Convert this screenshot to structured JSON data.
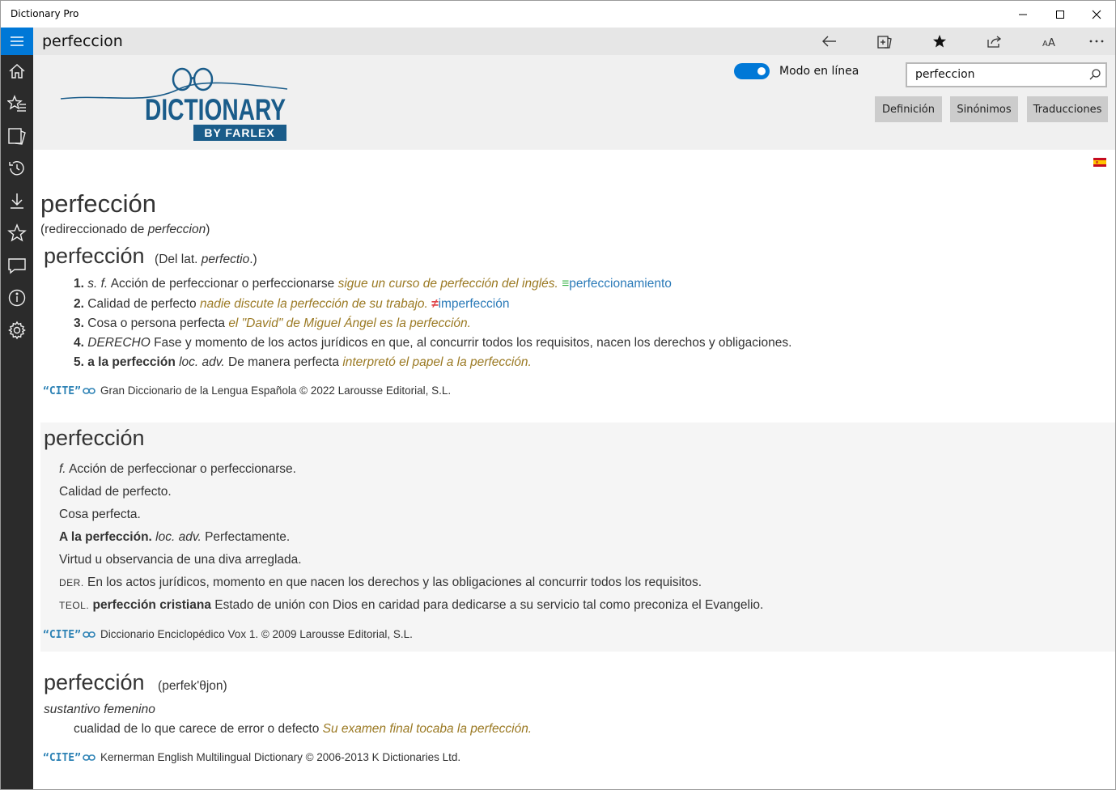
{
  "window": {
    "title": "Dictionary Pro",
    "controls": [
      "minimize",
      "maximize",
      "close"
    ]
  },
  "sidebar": {
    "items": [
      {
        "icon": "menu-icon"
      },
      {
        "icon": "home-icon"
      },
      {
        "icon": "starred-list-icon"
      },
      {
        "icon": "flashcards-icon"
      },
      {
        "icon": "history-icon"
      },
      {
        "icon": "download-icon"
      },
      {
        "icon": "star-outline-icon"
      },
      {
        "icon": "feedback-icon"
      },
      {
        "icon": "info-icon"
      },
      {
        "icon": "settings-icon"
      }
    ]
  },
  "cmdbar": {
    "query": "perfeccion",
    "icons": [
      "back-arrow-icon",
      "add-flashcard-icon",
      "favorite-star-icon",
      "share-icon",
      "font-size-icon",
      "more-icon"
    ]
  },
  "header": {
    "logo_title": "DICTIONARY",
    "logo_sub": "BY FARLEX",
    "toggle_label": "Modo en línea",
    "toggle_on": true,
    "search_value": "perfeccion",
    "tabs": [
      "Definición",
      "Sinónimos",
      "Traducciones"
    ]
  },
  "entry": {
    "headword": "perfección",
    "redirect_prefix": "(redireccionado de ",
    "redirect_word": "perfeccion",
    "redirect_suffix": ")",
    "section1": {
      "head": "perfección",
      "etym_prefix": "(Del lat. ",
      "etym_word": "perfectio",
      "etym_suffix": ".)",
      "defs": [
        {
          "n": "1.",
          "gram": "s. f.",
          "text": "Acción de perfeccionar o perfeccionarse",
          "example": "sigue un curso de perfección del inglés.",
          "rel_symbol": "≡",
          "rel": "perfeccionamiento"
        },
        {
          "n": "2.",
          "text": "Calidad de perfecto",
          "example": "nadie discute la perfección de su trabajo.",
          "rel_symbol": "≠",
          "rel": "imperfección"
        },
        {
          "n": "3.",
          "text": "Cosa o persona perfecta",
          "example": "el \"David\" de Miguel Ángel es la perfección."
        },
        {
          "n": "4.",
          "field": "DERECHO",
          "text": "Fase y momento de los actos jurídicos en que, al concurrir todos los requisitos, nacen los derechos y obligaciones."
        },
        {
          "n": "5.",
          "phrase": "a la perfección",
          "gram": "loc. adv.",
          "text": "De manera perfecta",
          "example": "interpretó el papel a la perfección."
        }
      ],
      "cite_label": "“CITE”",
      "source": "Gran Diccionario de la Lengua Española © 2022 Larousse Editorial, S.L."
    },
    "section2": {
      "head": "perfección",
      "lines": [
        {
          "gram": "f.",
          "text": "Acción de perfeccionar o perfeccionarse."
        },
        {
          "text": "Calidad de perfecto."
        },
        {
          "text": "Cosa perfecta."
        },
        {
          "phrase": "A la perfección.",
          "gram": "loc. adv.",
          "text": "Perfectamente."
        },
        {
          "text": "Virtud u observancia de una diva arreglada."
        },
        {
          "field": "DER.",
          "text": "En los actos jurídicos, momento en que nacen los derechos y las obligaciones al concurrir todos los requisitos."
        },
        {
          "field": "TEOL.",
          "phrase": "perfección cristiana",
          "text": "Estado de unión con Dios en caridad para dedicarse a su servicio tal como preconiza el Evangelio."
        }
      ],
      "cite_label": "“CITE”",
      "source": "Diccionario Enciclopédico Vox 1. © 2009 Larousse Editorial, S.L."
    },
    "section3": {
      "head": "perfección",
      "pron": "(perfek'θjon)",
      "pos": "sustantivo femenino",
      "def_text": "cualidad de lo que carece de error o defecto",
      "example": "Su examen final tocaba la perfección.",
      "cite_label": "“CITE”",
      "source": "Kernerman English Multilingual Dictionary © 2006-2013 K Dictionaries Ltd."
    }
  },
  "colors": {
    "accent": "#0078d7",
    "sidebar": "#2b2b2b",
    "example": "#9b7a24",
    "link": "#2a7ab8",
    "logo_blue": "#1a5c8a"
  }
}
